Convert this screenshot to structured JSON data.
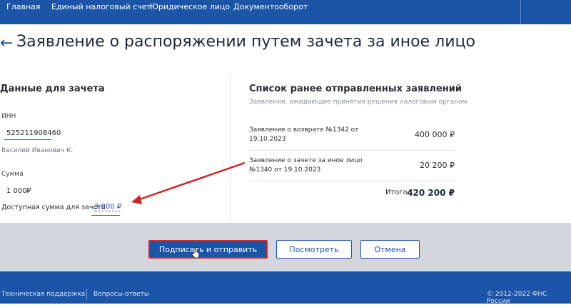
{
  "nav": {
    "items": [
      "Главная",
      "Единый налоговый счет",
      "Юридическое лицо",
      "Документооборот"
    ]
  },
  "page": {
    "back_icon": "←",
    "title": "Заявление о распоряжении путем зачета за иное лицо"
  },
  "left": {
    "heading": "Данные для зачета",
    "inn_label": "ИНН",
    "inn_value": "525211908460",
    "person": "Василий Иванович К.",
    "sum_label": "Сумма",
    "sum_value": "1 000",
    "currency": "₽",
    "available_label": "Доступная сумма для зачета",
    "available_value": "3 000 ₽"
  },
  "right": {
    "heading": "Список ранее отправленных заявлений",
    "hint": "Заявления, ожидающие принятия решения налоговым органом",
    "rows": [
      {
        "label": "Заявление о возврате №1342 от 19.10.2023",
        "amount": "400 000 ₽"
      },
      {
        "label": "Заявление о зачете за иное лицо №1340 от 19.10.2023",
        "amount": "20 200 ₽"
      }
    ],
    "total_label": "Итого",
    "total_value": "420 200 ₽"
  },
  "actions": {
    "sign_send": "Подписать и отправить",
    "view": "Посмотреть",
    "cancel": "Отмена"
  },
  "footer": {
    "support": "Техническая поддержка",
    "faq": "Вопросы-ответы",
    "copyright": "© 2012-2022 ФНС России"
  },
  "colors": {
    "brand": "#1c55a8",
    "annotation": "#d12a2a"
  }
}
